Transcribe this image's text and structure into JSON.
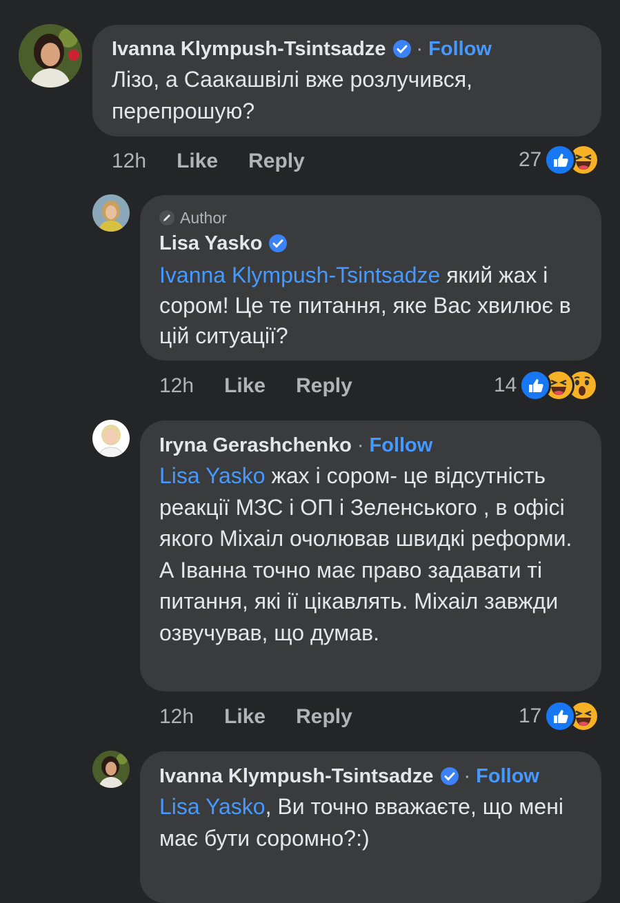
{
  "comments": [
    {
      "author": "Ivanna Klympush-Tsintsadze",
      "follow": "Follow",
      "text": "Лізо, а Саакашвілі вже розлучився, перепрошую?",
      "time": "12h",
      "like": "Like",
      "reply": "Reply",
      "reaction_count": "27"
    },
    {
      "badge": "Author",
      "author": "Lisa Yasko",
      "mention": "Ivanna Klympush-Tsintsadze",
      "text": " який жах і сором! Це те питання, яке Вас хвилює в цій ситуації?",
      "time": "12h",
      "like": "Like",
      "reply": "Reply",
      "reaction_count": "14"
    },
    {
      "author": "Iryna Gerashchenko",
      "follow": "Follow",
      "mention": "Lisa Yasko",
      "text": " жах і сором- це відсутність реакції МЗС і ОП і Зеленського , в офісі якого Міхаіл очолював швидкі реформи. А Іванна точно має право задавати ті питання, які ії цікавлять. Міхаіл завжди озвучував, що думав.",
      "time": "12h",
      "like": "Like",
      "reply": "Reply",
      "reaction_count": "17"
    },
    {
      "author": "Ivanna Klympush-Tsintsadze",
      "follow": "Follow",
      "mention": "Lisa Yasko",
      "text": ", Ви точно вважаєте, що мені має бути соромно?:)"
    }
  ],
  "colors": {
    "background": "#242526",
    "bubble": "#3a3b3c",
    "link": "#4599ff",
    "verified": "#3a82f6"
  }
}
